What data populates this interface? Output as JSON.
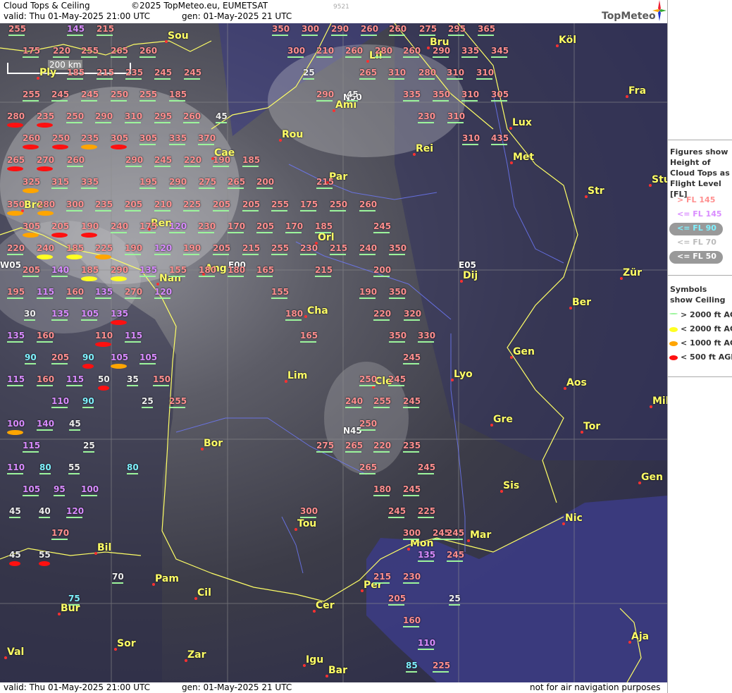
{
  "header": {
    "title": "Cloud Tops & Ceiling",
    "copyright": "©2025 TopMeteo.eu, EUMETSAT",
    "valid": "valid:  Thu  01-May-2025  21:00 UTC",
    "gen": "gen: 01-May-2025 21 UTC",
    "code": "9521",
    "logo": "TopMeteo"
  },
  "footer": {
    "valid": "valid:  Thu  01-May-2025  21:00 UTC",
    "gen": "gen: 01-May-2025 21 UTC",
    "disclaimer": "not for air navigation purposes"
  },
  "scale": "200 km",
  "legend": {
    "title": "Figures show Height of Cloud Tops as Flight Level  [FL]",
    "items": [
      {
        "label": "> FL 145",
        "color": "#ff8f8f"
      },
      {
        "label": "<= FL 145",
        "color": "#d98cff"
      },
      {
        "label": "<= FL 90",
        "color": "#7ff2ff"
      },
      {
        "label": "<= FL 70",
        "color": "#bbbbbb"
      },
      {
        "label": "<= FL 50",
        "color": "#ffffff"
      }
    ],
    "symbols_title": "Symbols show Ceiling",
    "symbols": [
      {
        "label": "> 2000 ft AGL",
        "color": "#9cf59c"
      },
      {
        "label": "< 2000 ft AGL",
        "color": "#ffff22"
      },
      {
        "label": "< 1000 ft AGL",
        "color": "#ffa500"
      },
      {
        "label": "< 500 ft AGL",
        "color": "#ff1010"
      }
    ]
  },
  "grid_labels": [
    "N50",
    "N45",
    "W05",
    "E00",
    "E05"
  ],
  "cities": [
    "Sou",
    "Köl",
    "Bru",
    "Lil",
    "Fra",
    "Ply",
    "Ami",
    "Lux",
    "Rou",
    "Rei",
    "Cae",
    "Met",
    "Par",
    "Stu",
    "Str",
    "Bre",
    "Ren",
    "Orl",
    "Ang",
    "Nan",
    "Dij",
    "Zür",
    "Cha",
    "Ber",
    "Gen",
    "Lim",
    "Cle",
    "Lyo",
    "Aos",
    "Mil",
    "Gre",
    "Tor",
    "Bor",
    "Gen",
    "Sis",
    "Tou",
    "Nic",
    "Mon",
    "Mar",
    "Bil",
    "Pam",
    "Cil",
    "Per",
    "Cer",
    "Bur",
    "Sor",
    "Aja",
    "Val",
    "Zar",
    "Igu",
    "Bar"
  ],
  "values": [
    "255",
    "145",
    "215",
    "350",
    "300",
    "290",
    "260",
    "260",
    "275",
    "295",
    "365",
    "175",
    "220",
    "255",
    "265",
    "260",
    "300",
    "210",
    "260",
    "280",
    "260",
    "290",
    "335",
    "345",
    "185",
    "215",
    "235",
    "245",
    "245",
    "25",
    "265",
    "310",
    "280",
    "310",
    "310",
    "255",
    "245",
    "245",
    "250",
    "255",
    "185",
    "290",
    "45",
    "335",
    "350",
    "310",
    "305",
    "280",
    "235",
    "250",
    "290",
    "310",
    "295",
    "260",
    "45",
    "230",
    "310",
    "260",
    "250",
    "235",
    "305",
    "305",
    "335",
    "370",
    "310",
    "435",
    "265",
    "270",
    "260",
    "290",
    "245",
    "220",
    "190",
    "185",
    "325",
    "315",
    "335",
    "195",
    "290",
    "275",
    "265",
    "200",
    "215",
    "350",
    "280",
    "300",
    "235",
    "205",
    "210",
    "225",
    "205",
    "205",
    "255",
    "175",
    "250",
    "260",
    "305",
    "205",
    "190",
    "240",
    "175",
    "120",
    "230",
    "170",
    "205",
    "170",
    "185",
    "245",
    "220",
    "240",
    "185",
    "225",
    "190",
    "120",
    "190",
    "205",
    "215",
    "255",
    "230",
    "215",
    "240",
    "350",
    "205",
    "140",
    "185",
    "290",
    "135",
    "155",
    "180",
    "180",
    "165",
    "215",
    "200",
    "195",
    "115",
    "160",
    "135",
    "270",
    "120",
    "155",
    "190",
    "350",
    "30",
    "135",
    "105",
    "135",
    "180",
    "220",
    "320",
    "135",
    "160",
    "110",
    "115",
    "165",
    "350",
    "330",
    "90",
    "205",
    "90",
    "105",
    "105",
    "245",
    "115",
    "160",
    "115",
    "50",
    "35",
    "150",
    "250",
    "245",
    "110",
    "90",
    "25",
    "255",
    "240",
    "255",
    "245",
    "100",
    "140",
    "45",
    "250",
    "115",
    "25",
    "275",
    "265",
    "220",
    "235",
    "110",
    "80",
    "55",
    "80",
    "265",
    "245",
    "105",
    "95",
    "100",
    "180",
    "245",
    "45",
    "40",
    "120",
    "300",
    "245",
    "225",
    "170",
    "300",
    "245",
    "245",
    "45",
    "55",
    "135",
    "245",
    "70",
    "215",
    "230",
    "75",
    "205",
    "25",
    "160",
    "110",
    "85",
    "225"
  ]
}
